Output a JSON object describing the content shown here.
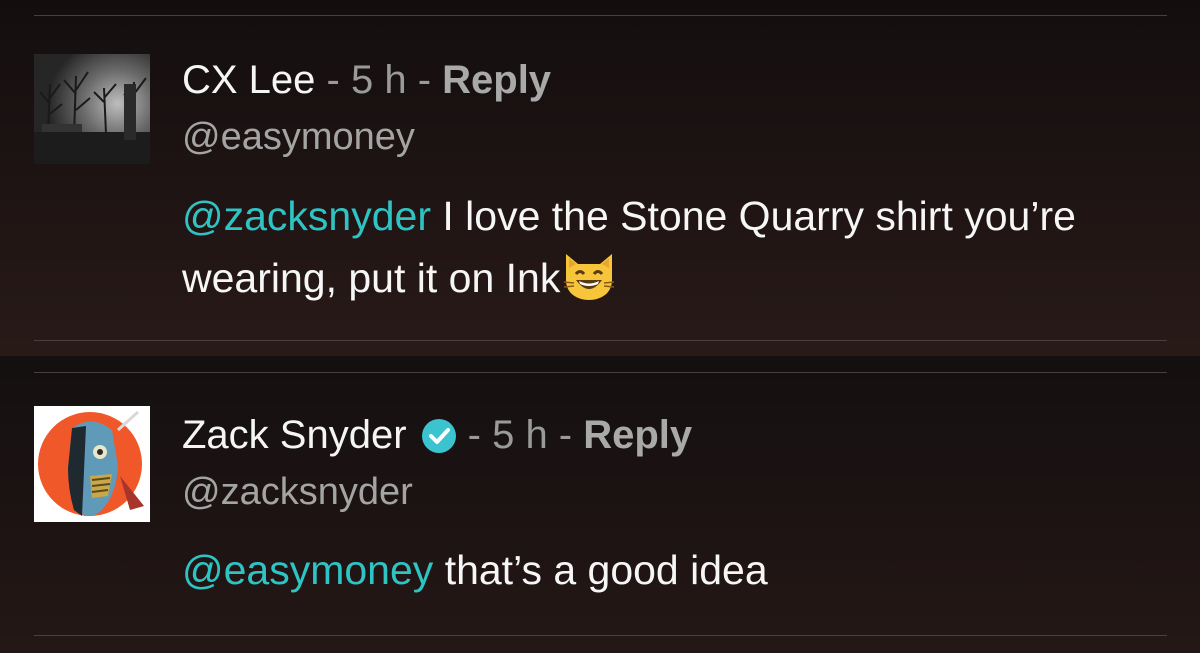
{
  "comments": [
    {
      "author": "CX Lee",
      "sep1": " - ",
      "time": "5 h",
      "sep2": " - ",
      "reply_label": "Reply",
      "handle": "@easymoney",
      "mention": "@zacksnyder",
      "text": " I love the Stone Quarry shirt you’re wearing, put it on Ink",
      "emoji": "grinning-cat-icon",
      "verified": false
    },
    {
      "author": "Zack Snyder",
      "sep1": " - ",
      "time": "5 h",
      "sep2": " - ",
      "reply_label": "Reply",
      "handle": "@zacksnyder",
      "mention": "@easymoney",
      "text": " that’s a good idea",
      "verified": true
    }
  ],
  "colors": {
    "mention": "#2ec4c4",
    "verified": "#3bc4d0",
    "meta": "#9a9a9a"
  }
}
